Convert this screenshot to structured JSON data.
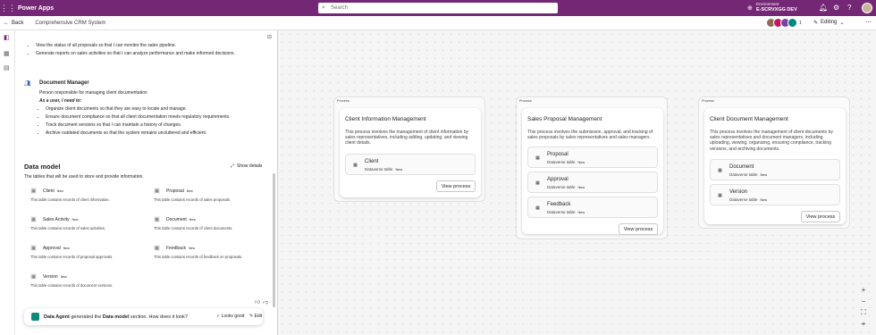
{
  "topbar": {
    "app_name": "Power Apps",
    "search_placeholder": "Search",
    "env_label": "Environment",
    "env_name": "E-SCRVXGG DEV"
  },
  "cmdbar": {
    "back_label": "Back",
    "breadcrumb": "Comprehensive CRM System",
    "collaborator_count": "1",
    "editing_label": "Editing"
  },
  "panel": {
    "top_bullets": [
      "View the status of all proposals so that I can monitor the sales pipeline.",
      "Generate reports on sales activities so that I can analyze performance and make informed decisions."
    ],
    "persona": {
      "name": "Document Manager",
      "description": "Person responsible for managing client documentation",
      "need_label": "As a user, I need to:",
      "needs": [
        "Organize client documents so that they are easy to locate and manage.",
        "Ensure document compliance so that all client documentation meets regulatory requirements.",
        "Track document versions so that I can maintain a history of changes.",
        "Archive outdated documents so that the system remains uncluttered and efficient."
      ]
    },
    "data_model": {
      "title": "Data model",
      "description": "The tables that will be used to store and provide information.",
      "show_details": "Show details",
      "tables": [
        {
          "name": "Client",
          "badge": "New",
          "desc": "This table contains records of client information."
        },
        {
          "name": "Proposal",
          "badge": "New",
          "desc": "This table contains records of sales proposals."
        },
        {
          "name": "Sales Activity",
          "badge": "New",
          "desc": "This table contains records of sales activities."
        },
        {
          "name": "Document",
          "badge": "New",
          "desc": "This table contains records of client documents."
        },
        {
          "name": "Approval",
          "badge": "New",
          "desc": "This table contains records of proposal approvals."
        },
        {
          "name": "Feedback",
          "badge": "New",
          "desc": "This table contains records of feedback on proposals."
        },
        {
          "name": "Version",
          "badge": "New",
          "desc": "This table contains records of document versions."
        }
      ]
    },
    "agent": {
      "name": "Data Agent",
      "mid": "generated the",
      "section": "Data model",
      "tail": "section. How does it look?",
      "looks_good": "Looks good",
      "edit": "Edit"
    }
  },
  "processes": [
    {
      "tag": "Process",
      "title": "Client Information Management",
      "description": "This process involves the management of client information by sales representatives, including adding, updating, and viewing client details.",
      "entities": [
        {
          "name": "Client",
          "type": "Dataverse table",
          "badge": "New"
        }
      ],
      "button": "View process"
    },
    {
      "tag": "Process",
      "title": "Sales Proposal Management",
      "description": "This process involves the submission, approval, and tracking of sales proposals by sales representatives and sales managers.",
      "entities": [
        {
          "name": "Proposal",
          "type": "Dataverse table",
          "badge": "New"
        },
        {
          "name": "Approval",
          "type": "Dataverse table",
          "badge": "New"
        },
        {
          "name": "Feedback",
          "type": "Dataverse table",
          "badge": "New"
        }
      ],
      "button": "View process"
    },
    {
      "tag": "Process",
      "title": "Client Document Management",
      "description": "This process involves the management of client documents by sales representatives and document managers, including uploading, viewing, organizing, ensuring compliance, tracking versions, and archiving documents.",
      "entities": [
        {
          "name": "Document",
          "type": "Dataverse table",
          "badge": "New"
        },
        {
          "name": "Version",
          "type": "Dataverse table",
          "badge": "New"
        }
      ],
      "button": "View process"
    }
  ],
  "colors": {
    "topbar": "#742774",
    "agent_icon": "#0e8a7a",
    "persona_icon": "#2b5fb3"
  },
  "icons": {
    "waffle": "waffle-icon",
    "search": "search-icon",
    "bell": "bell-icon",
    "settings": "gear-icon",
    "help": "help-icon"
  }
}
